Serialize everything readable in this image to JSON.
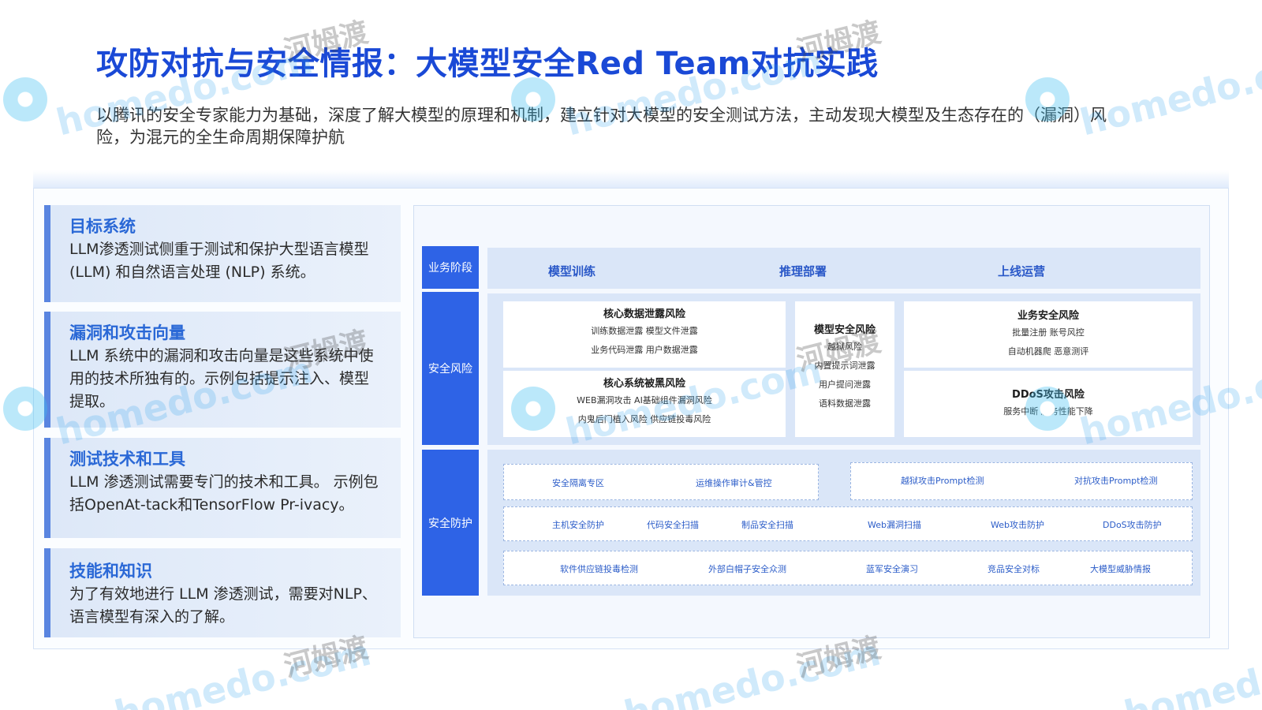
{
  "page": {
    "title": "攻防对抗与安全情报：大模型安全Red Team对抗实践",
    "subtitle": "以腾讯的安全专家能力为基础，深度了解大模型的原理和机制，建立针对大模型的安全测试方法，主动发现大模型及生态存在的（漏洞）风险，为混元的全生命周期保障护航"
  },
  "cards": [
    {
      "title": "目标系统",
      "text": "LLM渗透测试侧重于测试和保护大型语言模型 (LLM) 和自然语言处理 (NLP) 系统。"
    },
    {
      "title": "漏洞和攻击向量",
      "text": "LLM 系统中的漏洞和攻击向量是这些系统中使用的技术所独有的。示例包括提示注入、模型提取。"
    },
    {
      "title": "测试技术和工具",
      "text": "LLM 渗透测试需要专门的技术和工具。 示例包括OpenAt-tack和TensorFlow Pr-ivacy。"
    },
    {
      "title": "技能和知识",
      "text": "为了有效地进行 LLM 渗透测试，需要对NLP、语言模型有深入的了解。"
    }
  ],
  "matrix": {
    "row_labels": {
      "stage": "业务阶段",
      "risk": "安全风险",
      "defense": "安全防护"
    },
    "stages": [
      "模型训练",
      "推理部署",
      "上线运营"
    ],
    "risk_boxes": {
      "data_leak": {
        "title": "核心数据泄露风险",
        "lines": [
          "训练数据泄露    模型文件泄露",
          "业务代码泄露    用户数据泄露"
        ]
      },
      "system_intrusion": {
        "title": "核心系统被黑风险",
        "lines": [
          "WEB漏洞攻击  AI基础组件漏洞风险",
          "内鬼后门植入风险 供应链投毒风险"
        ]
      },
      "model_security": {
        "title": "模型安全风险",
        "lines": [
          "越狱风险",
          "内置提示词泄露",
          "用户提问泄露",
          "语料数据泄露"
        ]
      },
      "business_security": {
        "title": "业务安全风险",
        "lines": [
          "批量注册    账号风控",
          "自动机器爬    恶意测评"
        ]
      },
      "ddos": {
        "title": "DDoS攻击风险",
        "lines": [
          "服务中断 服务性能下降"
        ]
      }
    },
    "defense_rows": {
      "row1_left": [
        "安全隔离专区",
        "运维操作审计&管控"
      ],
      "row1_right": [
        "越狱攻击Prompt检测",
        "对抗攻击Prompt检测"
      ],
      "row2": [
        "主机安全防护",
        "代码安全扫描",
        "制品安全扫描",
        "Web漏洞扫描",
        "Web攻击防护",
        "DDoS攻击防护"
      ],
      "row3": [
        "软件供应链投毒检测",
        "外部白帽子安全众测",
        "蓝军安全演习",
        "竞品安全对标",
        "大模型威胁情报"
      ]
    }
  },
  "watermarks": {
    "latin": "homedo.com",
    "chinese": "河姆渡"
  },
  "colors": {
    "title": "#1a49d6",
    "label_bg": "#2e63e6",
    "card_accent": "#5a85e0",
    "stage_text": "#2a58c8"
  }
}
